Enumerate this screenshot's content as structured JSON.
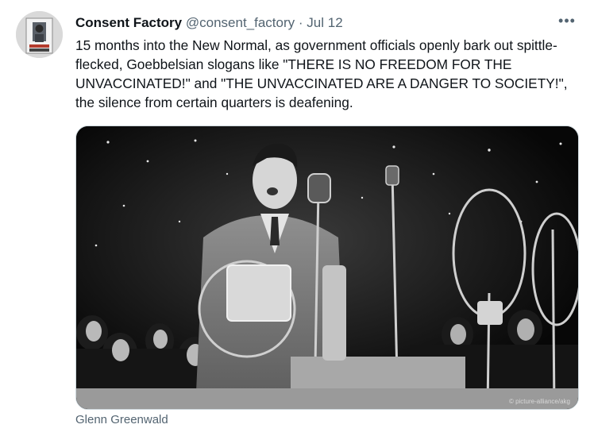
{
  "tweet": {
    "author_name": "Consent Factory",
    "handle": "@consent_factory",
    "separator": "·",
    "date": "Jul 12",
    "more_label": "•••",
    "text": "15 months into the New Normal, as government officials openly bark out spittle-flecked, Goebbelsian slogans like \"THERE IS NO FREEDOM FOR THE UNVACCINATED!\" and \"THE UNVACCINATED ARE A DANGER TO SOCIETY!\", the silence from certain quarters is deafening.",
    "image_credit": "© picture-alliance/akg",
    "footer_text": "Glenn Greenwald"
  },
  "icons": {
    "avatar": "avatar-image",
    "more": "more-options-icon"
  },
  "colors": {
    "text_primary": "#0f1419",
    "text_secondary": "#536471",
    "border": "#cfd9de",
    "background": "#ffffff"
  }
}
